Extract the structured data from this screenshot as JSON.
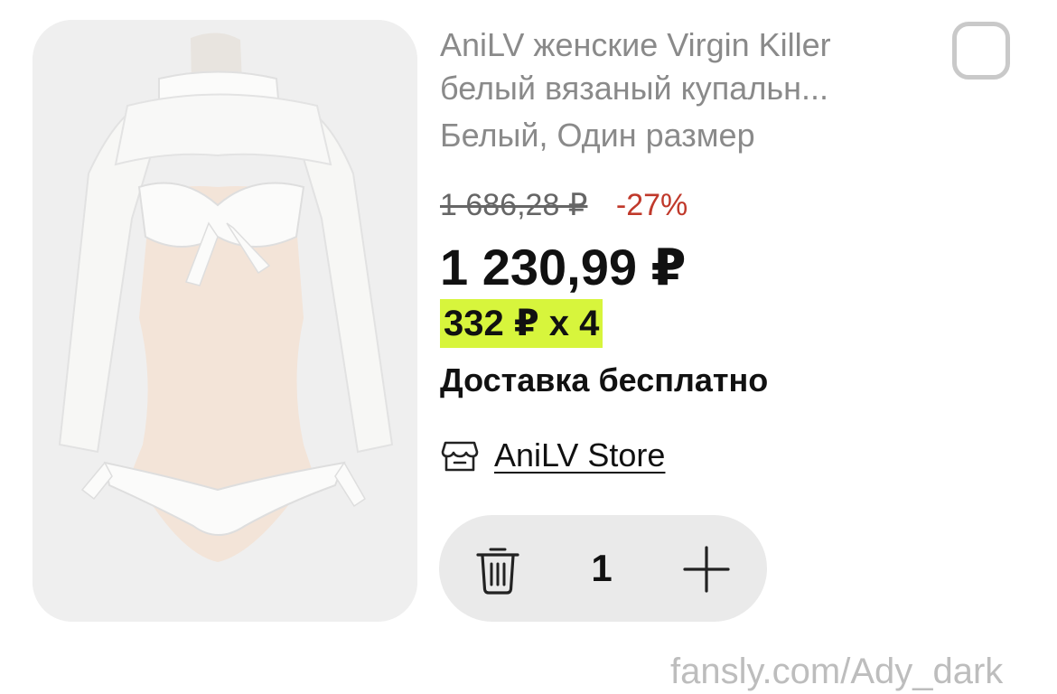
{
  "product": {
    "title_line1": "AniLV женские Virgin Killer",
    "title_line2": "белый вязаный купальн...",
    "variant": "Белый, Один размер",
    "old_price": "1 686,28 ₽",
    "discount": "-27%",
    "price": "1 230,99 ₽",
    "installment": "332 ₽ x 4",
    "delivery": "Доставка бесплатно",
    "store_name": "AniLV Store",
    "quantity": "1",
    "icons": {
      "store": "store-icon",
      "delete": "trash-icon",
      "increase": "plus-icon",
      "select": "checkbox-icon"
    }
  },
  "colors": {
    "installment_highlight": "#d7f53c",
    "discount": "#c0392b",
    "muted_text": "#8a8a8a"
  },
  "watermark": "fansly.com/Ady_dark"
}
